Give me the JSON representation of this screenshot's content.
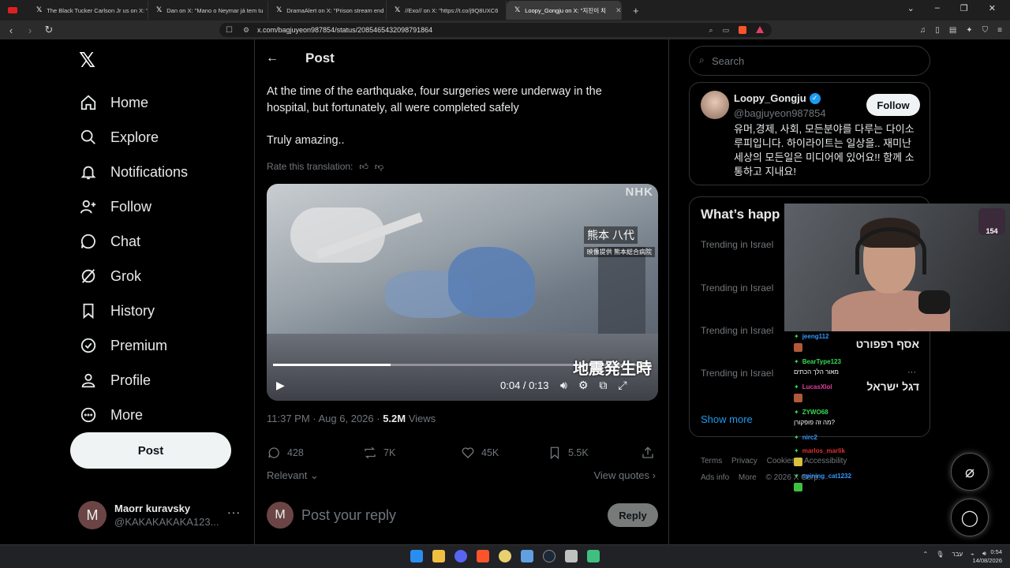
{
  "browser": {
    "tabs": [
      {
        "label": "The Black Tucker Carlson Jr us on X: \""
      },
      {
        "label": "Dan on X: \"Mano o Neymar já tem tu"
      },
      {
        "label": "DramaAlert on X: \"Prison stream end"
      },
      {
        "label": "//Exo// on X: \"https://t.co/j9Q8UXC6"
      },
      {
        "label": "Loopy_Gongju on X: \"지진이 치"
      }
    ],
    "url": "x.com/bagjuyeon987854/status/2085465432098791864"
  },
  "nav": {
    "logo": "𝕏",
    "items": [
      {
        "label": "Home",
        "icon": "home-icon"
      },
      {
        "label": "Explore",
        "icon": "search-icon"
      },
      {
        "label": "Notifications",
        "icon": "bell-icon"
      },
      {
        "label": "Follow",
        "icon": "person-plus-icon"
      },
      {
        "label": "Chat",
        "icon": "chat-icon"
      },
      {
        "label": "Grok",
        "icon": "grok-icon"
      },
      {
        "label": "History",
        "icon": "bookmark-icon"
      },
      {
        "label": "Premium",
        "icon": "verified-icon"
      },
      {
        "label": "Profile",
        "icon": "person-icon"
      },
      {
        "label": "More",
        "icon": "more-circle-icon"
      }
    ],
    "post_label": "Post",
    "account": {
      "initial": "M",
      "name": "Maorr kuravsky",
      "handle": "@KAKAKAKAKA123..."
    }
  },
  "header": {
    "title": "Post"
  },
  "tweet": {
    "text_line1": "At the time of the earthquake, four surgeries were underway in the hospital, but fortunately, all were completed safely",
    "text_line2": "Truly amazing..",
    "rate_label": "Rate this translation:",
    "video": {
      "watermark": "NHK",
      "caption_top": "熊本 八代",
      "caption_small": "映像提供 熊本総合病院",
      "caption_bottom": "地震発生時",
      "time": "0:04 / 0:13",
      "progress": 0.31
    },
    "meta_time": "11:37 PM · Aug 6, 2026 · ",
    "views_count": "5.2M",
    "views_label": " Views",
    "stats": {
      "replies": "428",
      "reposts": "7K",
      "likes": "45K",
      "bookmarks": "5.5K"
    },
    "relevant_label": "Relevant",
    "view_quotes_label": "View quotes",
    "reply_initial": "M",
    "reply_placeholder": "Post your reply",
    "reply_button": "Reply"
  },
  "right": {
    "search_placeholder": "Search",
    "profile": {
      "name": "Loopy_Gongju",
      "handle": "@bagjuyeon987854",
      "follow_label": "Follow",
      "bio": "유머,경제, 사회, 모든분야를 다루는 다이소 루피입니다. 하이라이트는 일상을.. 재미난 세상의 모든일은 미디어에 있어요!! 함께 소통하고 지내요!"
    },
    "happening_title": "What’s happ",
    "trends": [
      {
        "context": "Trending in Israel",
        "name": ""
      },
      {
        "context": "Trending in Israel",
        "name": ""
      },
      {
        "context": "Trending in Israel",
        "name": "אסף רפפורט"
      },
      {
        "context": "Trending in Israel",
        "name": "דגל ישראל"
      }
    ],
    "show_more": "Show more",
    "footer": [
      "Terms",
      "Privacy",
      "Cookies",
      "Accessibility",
      "Ads info",
      "More",
      "© 2026 X Corp."
    ]
  },
  "stream": {
    "badge": "154",
    "chat": [
      {
        "user": "jeeng112",
        "text": "",
        "color": "#3399ff"
      },
      {
        "user": "BearType123",
        "text": "מאור הלך הכתים",
        "color": "#33dd55"
      },
      {
        "user": "LucasXlol",
        "text": "",
        "color": "#e040a0"
      },
      {
        "user": "ZYWO68",
        "text": "מה זה פופקורן?",
        "color": "#33dd55"
      },
      {
        "user": "nirc2",
        "text": "",
        "color": "#3399ff"
      },
      {
        "user": "marlos_marlik",
        "text": "",
        "color": "#e03030"
      },
      {
        "user": "spining_cat1232",
        "text": "",
        "color": "#3399ff"
      }
    ]
  },
  "taskbar": {
    "lang": "עבר",
    "time": "0:54",
    "date": "14/08/2026"
  }
}
